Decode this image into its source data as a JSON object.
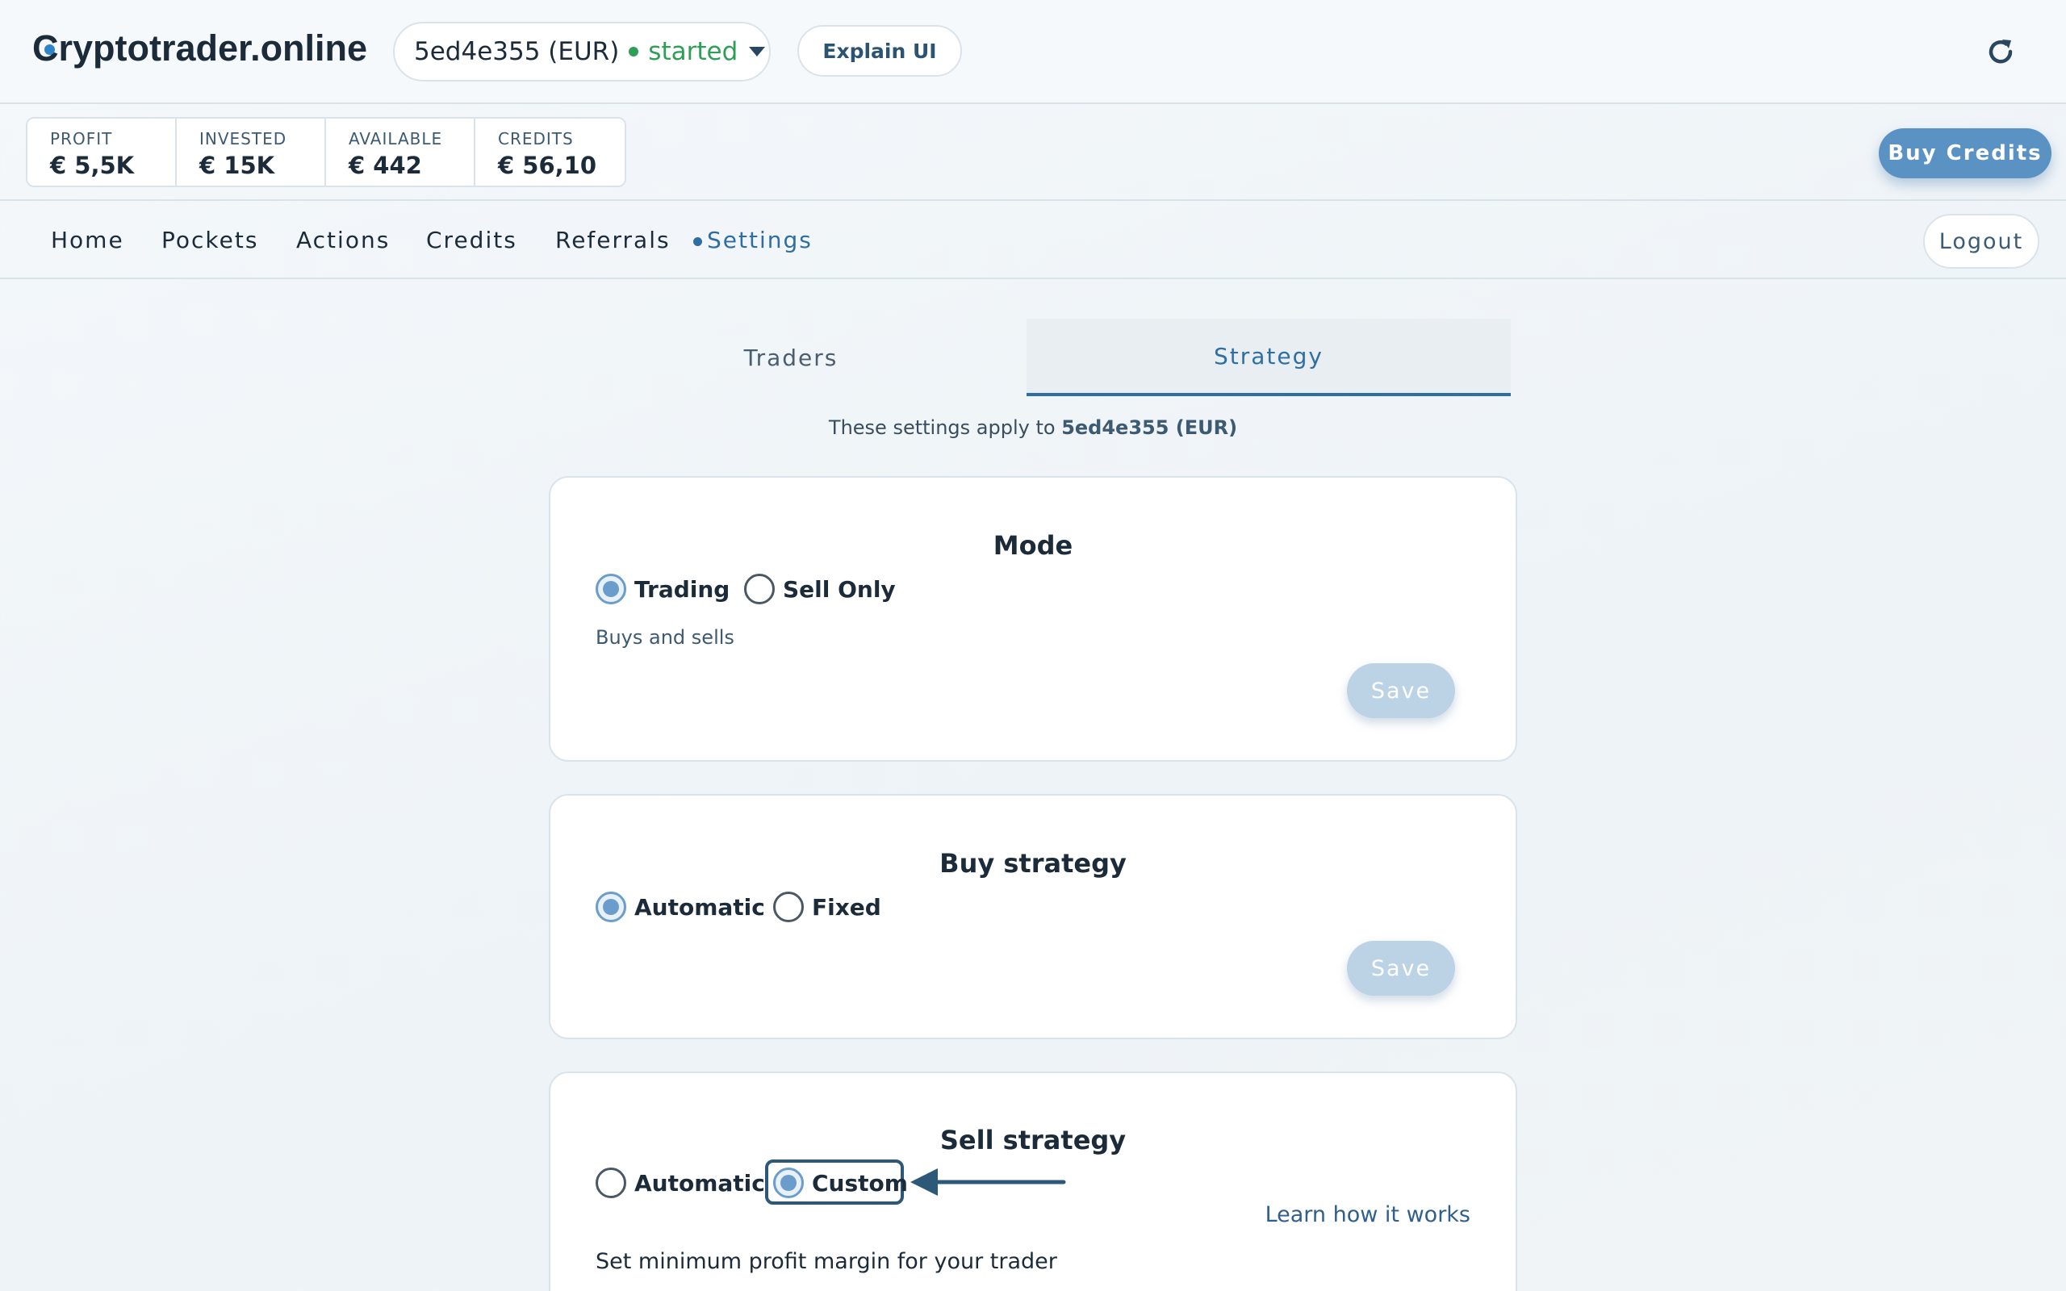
{
  "header": {
    "logo_text": "Cryptotrader.online",
    "trader_name": "5ed4e355 (EUR)",
    "trader_status": "started",
    "explain_label": "Explain UI"
  },
  "stats": [
    {
      "label": "PROFIT",
      "value": "€ 5,5K"
    },
    {
      "label": "INVESTED",
      "value": "€ 15K"
    },
    {
      "label": "AVAILABLE",
      "value": "€ 442"
    },
    {
      "label": "CREDITS",
      "value": "€ 56,10"
    }
  ],
  "buy_credits_label": "Buy Credits",
  "nav": {
    "items": [
      "Home",
      "Pockets",
      "Actions",
      "Credits",
      "Referrals",
      "Settings"
    ],
    "active": "Settings",
    "logout_label": "Logout"
  },
  "tabs": [
    "Traders",
    "Strategy"
  ],
  "apply_note": {
    "prefix": "These settings apply to ",
    "trader": "5ed4e355 (EUR)"
  },
  "mode": {
    "title": "Mode",
    "options": [
      "Trading",
      "Sell Only"
    ],
    "selected": "Trading",
    "description": "Buys and sells",
    "save_label": "Save"
  },
  "buy_strategy": {
    "title": "Buy strategy",
    "options": [
      "Automatic",
      "Fixed"
    ],
    "selected": "Automatic",
    "save_label": "Save"
  },
  "sell_strategy": {
    "title": "Sell strategy",
    "options": [
      "Automatic",
      "Custom"
    ],
    "selected": "Custom",
    "learn_link": "Learn how it works",
    "margin_text": "Set minimum profit margin for your trader"
  },
  "colors": {
    "accent": "#2f6ea3",
    "status_green": "#2f9e57",
    "button_blue": "#5a92c4"
  }
}
